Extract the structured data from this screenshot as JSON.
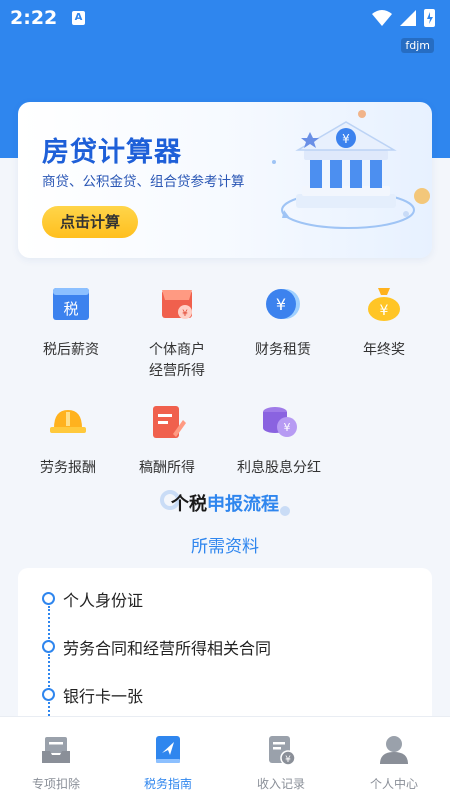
{
  "status_bar": {
    "time": "2:22",
    "notification_glyph": "A",
    "watermark": "fdjm"
  },
  "banner": {
    "title": "房贷计算器",
    "subtitle": "商贷、公积金贷、组合贷参考计算",
    "button": "点击计算"
  },
  "grid": [
    {
      "label": "税后薪资",
      "icon": "tax-icon"
    },
    {
      "label": "个体商户\n经营所得",
      "icon": "shop-icon"
    },
    {
      "label": "财务租赁",
      "icon": "yen-coin-icon"
    },
    {
      "label": "年终奖",
      "icon": "money-bag-icon"
    },
    {
      "label": "劳务报酬",
      "icon": "hard-hat-icon"
    },
    {
      "label": "稿酬所得",
      "icon": "document-edit-icon"
    },
    {
      "label": "利息股息分红",
      "icon": "coin-stack-icon"
    }
  ],
  "section": {
    "title_part1": "个税",
    "title_part2": "申报流程",
    "link": "所需资料"
  },
  "materials": [
    "个人身份证",
    "劳务合同和经营所得相关合同",
    "银行卡一张"
  ],
  "tabs": [
    {
      "label": "专项扣除",
      "icon": "inbox-tray-icon",
      "active": false
    },
    {
      "label": "税务指南",
      "icon": "guide-book-icon",
      "active": true
    },
    {
      "label": "收入记录",
      "icon": "receipt-yen-icon",
      "active": false
    },
    {
      "label": "个人中心",
      "icon": "user-icon",
      "active": false
    }
  ],
  "colors": {
    "primary": "#2f86ee",
    "accent_yellow": "#ffc526",
    "tab_inactive": "#8a8f98"
  }
}
